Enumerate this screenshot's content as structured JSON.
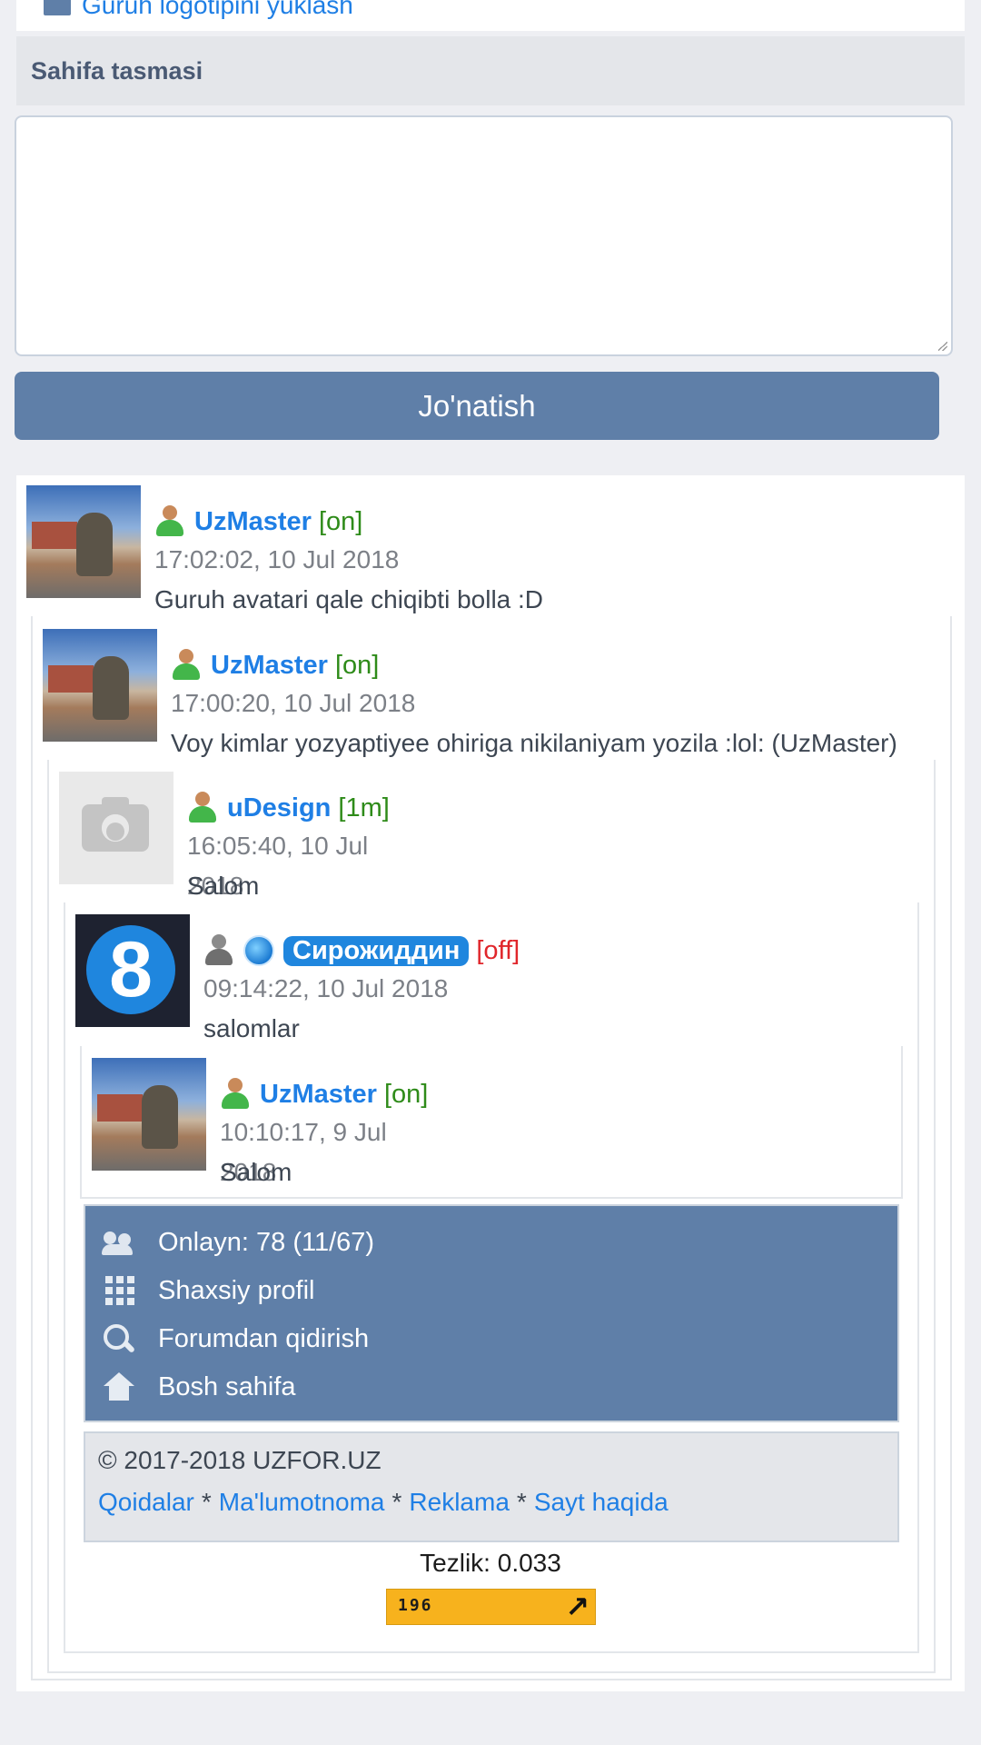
{
  "top": {
    "link_label": "Guruh logotipini yuklash"
  },
  "section": {
    "title": "Sahifa tasmasi"
  },
  "form": {
    "message_value": "",
    "send_label": "Jo'natish"
  },
  "comments": [
    {
      "user": "UzMaster",
      "status": "[on]",
      "status_type": "on",
      "time": "17:02:02, 10 Jul 2018",
      "text": "Guruh avatari qale chiqibti bolla :D",
      "avatar": "photo"
    },
    {
      "user": "UzMaster",
      "status": "[on]",
      "status_type": "on",
      "time": "17:00:20, 10 Jul 2018",
      "text": "Voy kimlar yozyaptiyee ohiriga nikilaniyam yozila :lol: (UzMaster)",
      "avatar": "photo"
    },
    {
      "user": "uDesign",
      "status": "[1m]",
      "status_type": "away",
      "time": "16:05:40, 10 Jul 2018",
      "text": "Salom",
      "avatar": "camera"
    },
    {
      "user": "Сирожиддин",
      "status": "[off]",
      "status_type": "off",
      "time": "09:14:22, 10 Jul 2018",
      "text": "salomlar",
      "avatar": "eight-logo"
    },
    {
      "user": "UzMaster",
      "status": "[on]",
      "status_type": "on",
      "time": "10:10:17, 9 Jul 2018",
      "text": "Salom",
      "avatar": "photo"
    }
  ],
  "menu": {
    "items": [
      {
        "icon": "users-icon",
        "label": "Onlayn: 78 (11/67)"
      },
      {
        "icon": "grid-icon",
        "label": "Shaxsiy profil"
      },
      {
        "icon": "search-icon",
        "label": "Forumdan qidirish"
      },
      {
        "icon": "home-icon",
        "label": "Bosh sahifa"
      }
    ]
  },
  "footer": {
    "copyright": "© 2017-2018 UZFOR.UZ",
    "links": [
      "Qoidalar",
      "Ma'lumotnoma",
      "Reklama",
      "Sayt haqida"
    ],
    "separator": "*",
    "speed": "Tezlik: 0.033",
    "counter": "196"
  },
  "colors": {
    "accent": "#5f7fa8",
    "link": "#1f7fe5",
    "online": "#2e8b19",
    "offline": "#e0262b",
    "counter_bg": "#f7b21d"
  }
}
